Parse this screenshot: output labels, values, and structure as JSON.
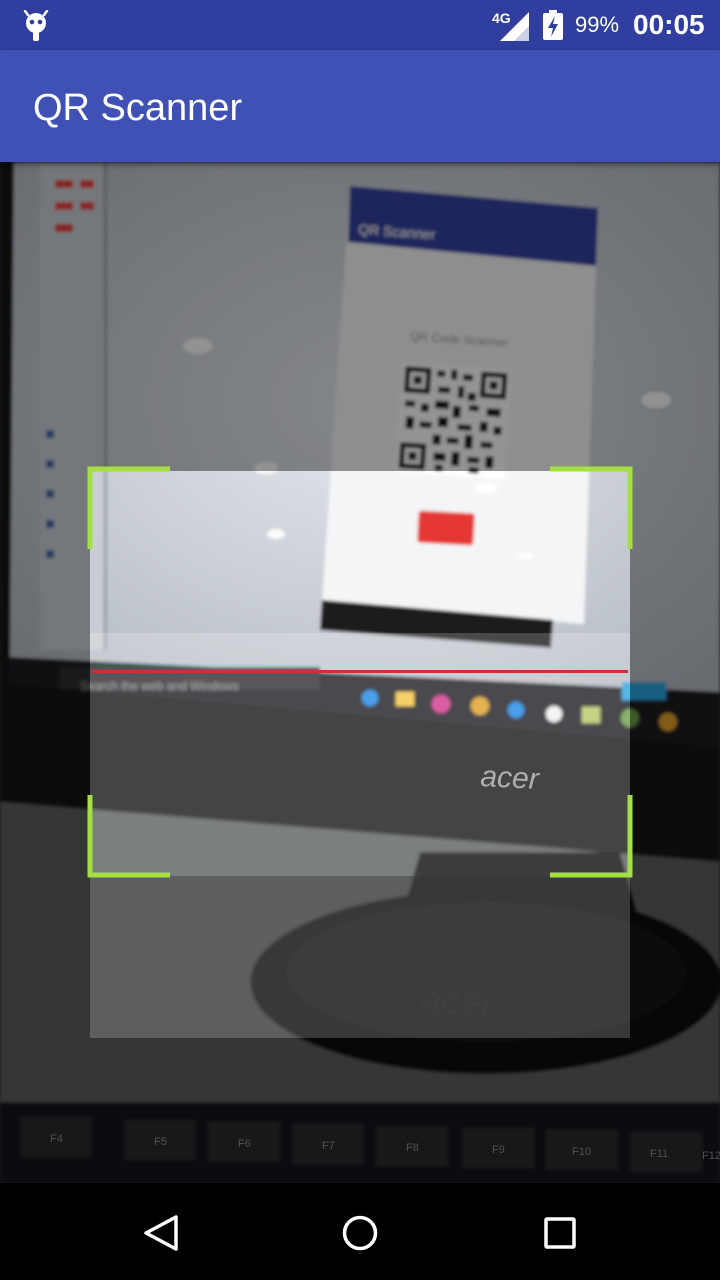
{
  "status_bar": {
    "network_type": "4G",
    "battery_percent": "99%",
    "time": "00:05",
    "icons": [
      "android-bug-icon",
      "signal-icon",
      "battery-charging-icon"
    ],
    "color": "#303f9f"
  },
  "toolbar": {
    "title": "QR Scanner",
    "color": "#3f51b5"
  },
  "scanner": {
    "frame_corner_color": "#a4e043",
    "laser_color": "#d32f2f"
  },
  "camera_view": {
    "monitor_brand": "acer",
    "phone_app_title": "QR Scanner",
    "phone_heading": "QR Code Scanner",
    "taskbar_search": "Search the web and Windows",
    "keyboard_keys": [
      "F4",
      "F5",
      "F6",
      "F7",
      "F8",
      "F9",
      "F10",
      "F11",
      "F12"
    ]
  },
  "nav_bar": {
    "icons": [
      "back-icon",
      "home-icon",
      "recents-icon"
    ]
  }
}
